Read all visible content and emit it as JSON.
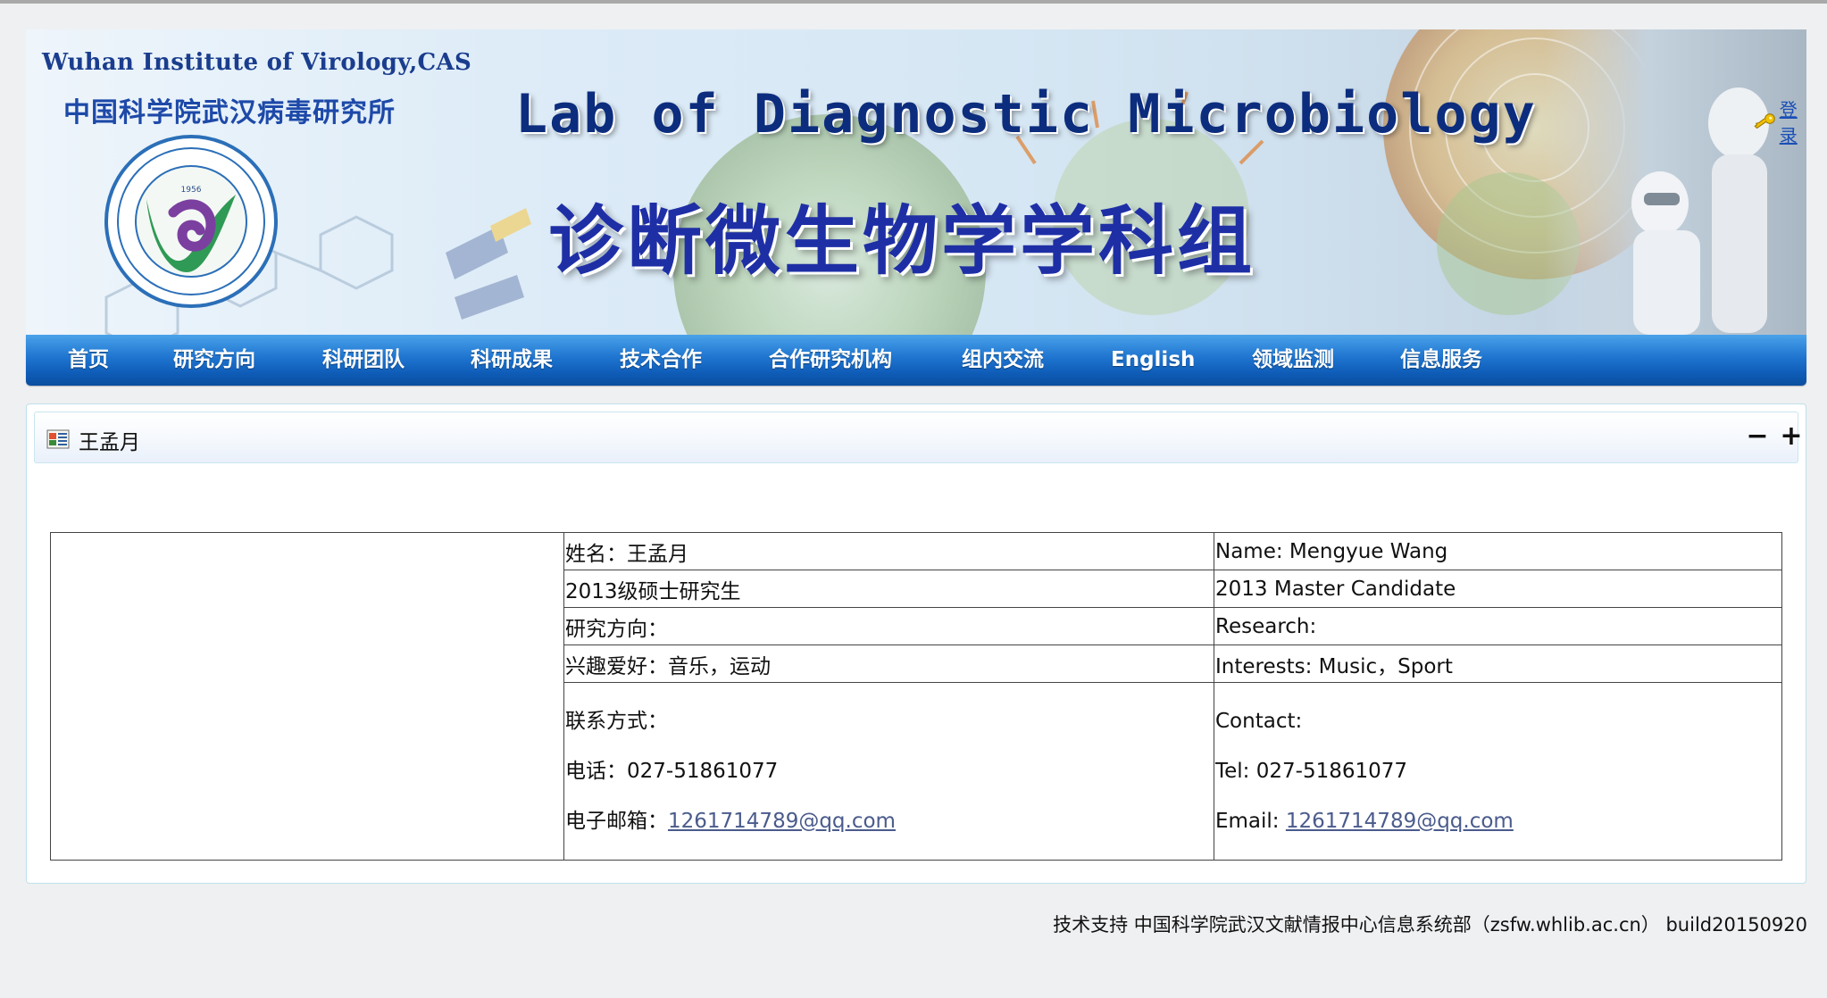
{
  "banner": {
    "institute_en": "Wuhan Institute of Virology,CAS",
    "institute_cn": "中国科学院武汉病毒研究所",
    "logo_year": "1956",
    "lab_title_en": "Lab of Diagnostic Microbiology",
    "lab_title_cn": "诊断微生物学学科组",
    "login_label": "登录"
  },
  "nav": {
    "items": [
      {
        "label": "首页"
      },
      {
        "label": "研究方向"
      },
      {
        "label": "科研团队"
      },
      {
        "label": "科研成果"
      },
      {
        "label": "技术合作"
      },
      {
        "label": "合作研究机构"
      },
      {
        "label": "组内交流"
      },
      {
        "label": "English"
      },
      {
        "label": "领域监测"
      },
      {
        "label": "信息服务"
      }
    ]
  },
  "panel": {
    "title": "王孟月",
    "minimize_label": "−",
    "maximize_label": "+"
  },
  "profile": {
    "cn": {
      "name": "姓名：王孟月",
      "degree": "2013级硕士研究生",
      "research": "研究方向：",
      "interests": "兴趣爱好：音乐，运动",
      "contact": "联系方式：",
      "phone": "电话：027-51861077",
      "email_label": "电子邮箱：",
      "email": "1261714789@qq.com"
    },
    "en": {
      "name": "Name: Mengyue Wang",
      "degree": "2013 Master Candidate",
      "research": "Research:",
      "interests": "Interests: Music，Sport",
      "contact": "Contact:",
      "phone": "Tel: 027-51861077",
      "email_label": "Email: ",
      "email": "1261714789@qq.com"
    }
  },
  "footer": {
    "text": "技术支持 中国科学院武汉文献情报中心信息系统部（zsfw.whlib.ac.cn） build20150920"
  },
  "colors": {
    "nav_blue": "#1e74cf",
    "title_navy": "#0c2d7e",
    "title_cn_blue": "#1e2fa6",
    "link": "#4a5b8c",
    "panel_border": "#bfe0ea"
  }
}
